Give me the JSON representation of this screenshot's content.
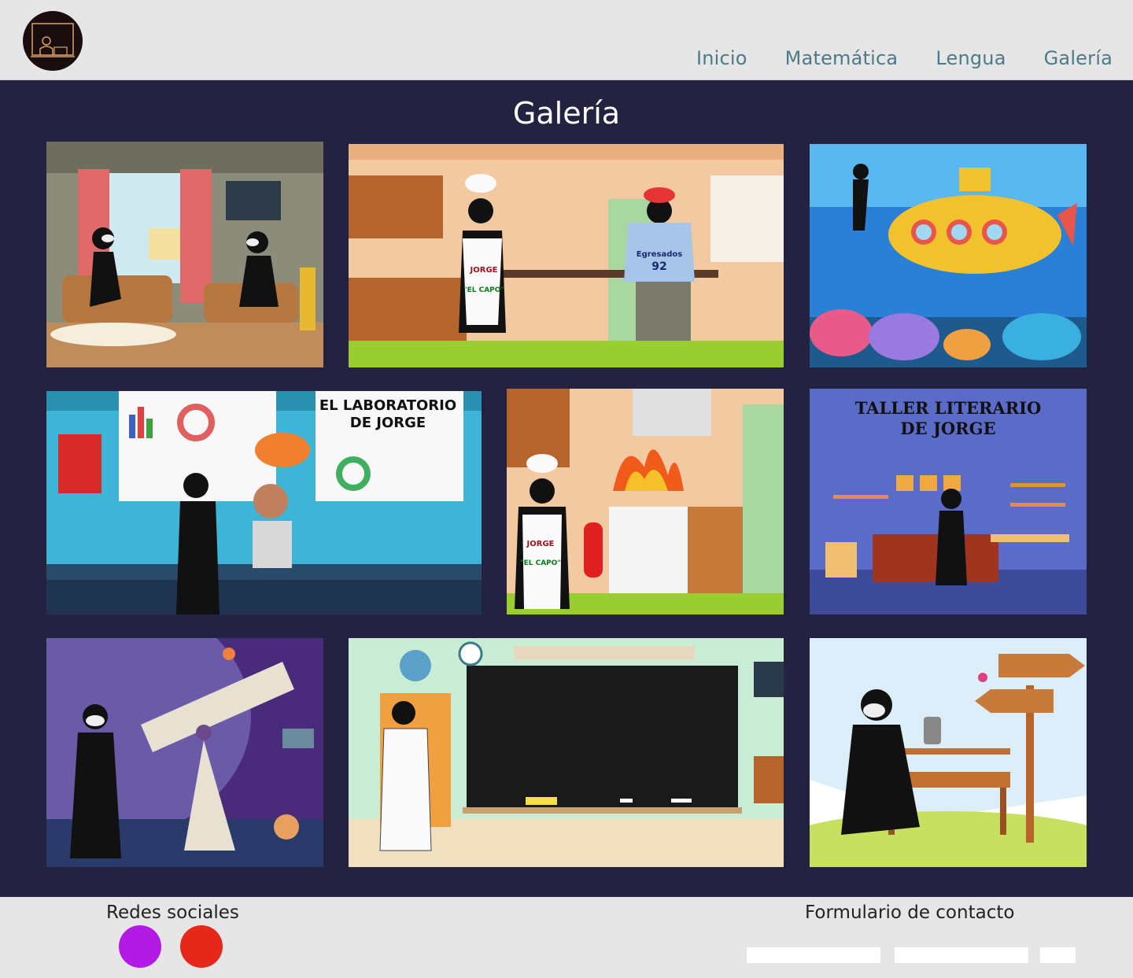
{
  "header": {
    "logo_icon": "teacher-at-blackboard-icon",
    "nav": [
      {
        "label": "Inicio"
      },
      {
        "label": "Matemática"
      },
      {
        "label": "Lengua"
      },
      {
        "label": "Galería"
      }
    ]
  },
  "main": {
    "title": "Galería",
    "background_color": "#232341",
    "gallery": [
      {
        "scene": "living-room-conversation"
      },
      {
        "scene": "kitchen-chef-and-student",
        "texts": [
          "JORGE",
          "\"EL CAPO\"",
          "Egresados",
          "92"
        ]
      },
      {
        "scene": "underwater-submarine-diver"
      },
      {
        "scene": "science-laboratory",
        "texts": [
          "EL LABORATORIO",
          "DE JORGE"
        ]
      },
      {
        "scene": "kitchen-fire-extinguisher",
        "texts": [
          "JORGE",
          "\"EL CAPO\""
        ]
      },
      {
        "scene": "literary-workshop",
        "texts": [
          "TALLER LITERARIO",
          "DE JORGE"
        ]
      },
      {
        "scene": "telescope-space"
      },
      {
        "scene": "classroom-blackboard"
      },
      {
        "scene": "park-bench-signpost"
      }
    ]
  },
  "footer": {
    "social_title": "Redes sociales",
    "social_icons": [
      {
        "name": "purple-social-icon",
        "color": "#b31ae6"
      },
      {
        "name": "red-social-icon",
        "color": "#e6281a"
      }
    ],
    "contact_title": "Formulario de contacto"
  }
}
